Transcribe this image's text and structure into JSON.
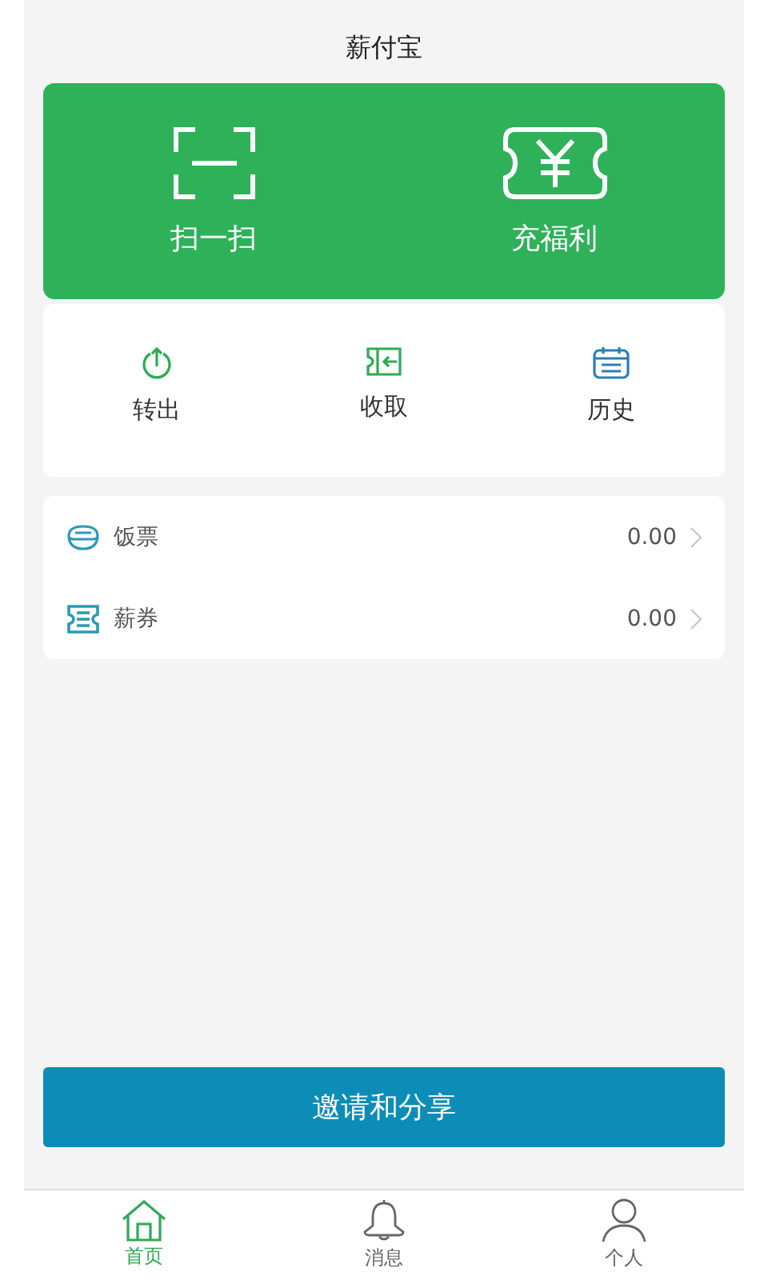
{
  "header": {
    "title": "薪付宝"
  },
  "hero_actions": [
    {
      "kind": "scan",
      "label": "扫一扫"
    },
    {
      "kind": "ticket",
      "label": "充福利"
    }
  ],
  "quick_actions": [
    {
      "kind": "transfer",
      "label": "转出"
    },
    {
      "kind": "receive",
      "label": "收取"
    },
    {
      "kind": "history",
      "label": "历史"
    }
  ],
  "balances": [
    {
      "kind": "meal",
      "label": "饭票",
      "value": "0.00"
    },
    {
      "kind": "coupon",
      "label": "薪券",
      "value": "0.00"
    }
  ],
  "invite_button": "邀请和分享",
  "tab_bar": [
    {
      "kind": "home",
      "label": "首页",
      "selected": true
    },
    {
      "kind": "bell",
      "label": "消息",
      "selected": false
    },
    {
      "kind": "person",
      "label": "个人",
      "selected": false
    }
  ]
}
